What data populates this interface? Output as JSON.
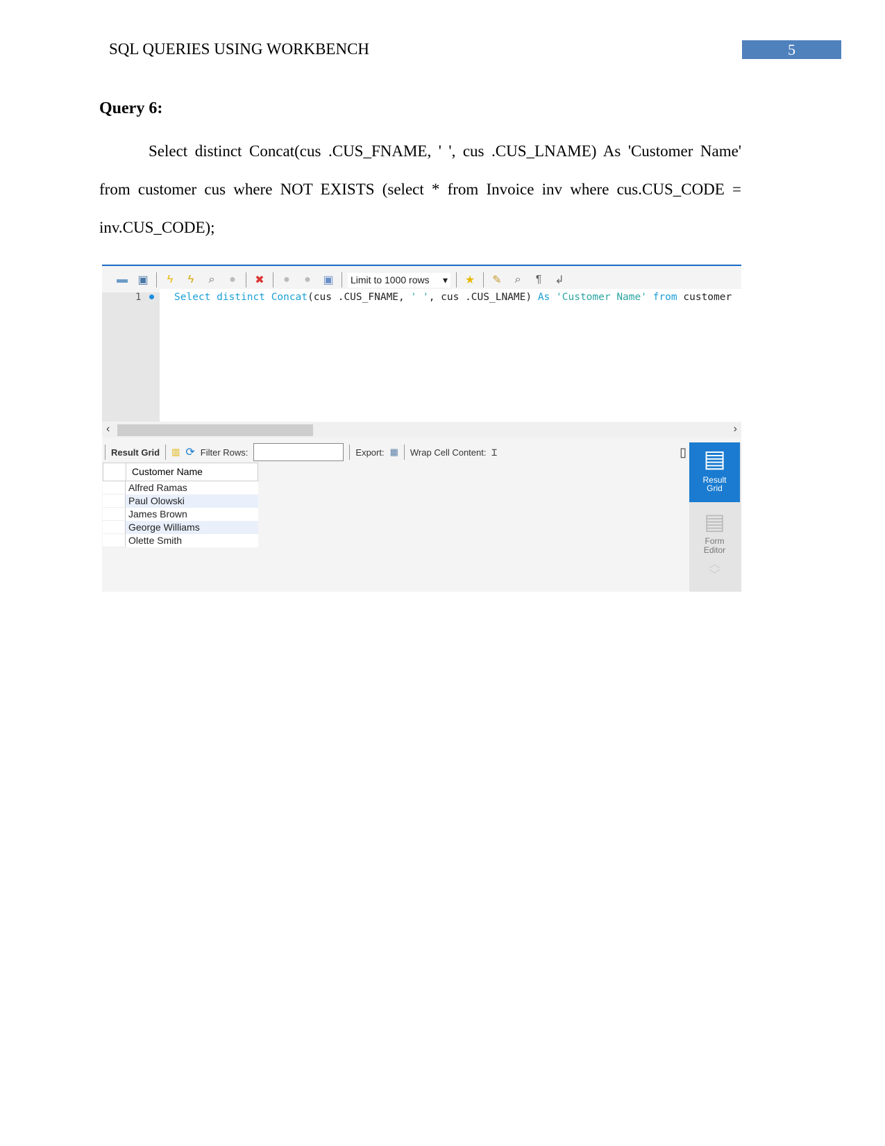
{
  "header": {
    "title": "SQL QUERIES USING WORKBENCH",
    "page_number": "5",
    "accent_color": "#4f81bd"
  },
  "query": {
    "heading": "Query 6:",
    "text": "Select distinct Concat(cus .CUS_FNAME, ' ', cus .CUS_LNAME) As 'Customer Name' from customer cus where NOT EXISTS (select * from Invoice inv where cus.CUS_CODE = inv.CUS_CODE);"
  },
  "workbench": {
    "limit_label": "Limit to 1000 rows",
    "line_number": "1",
    "code": {
      "t1": "Select distinct ",
      "t2": "Concat",
      "t3": "(cus .CUS_FNAME, ",
      "t4": "' '",
      "t5": ", cus .CUS_LNAME) ",
      "t6": "As ",
      "t7": "'Customer Name'",
      "t8": " from ",
      "t9": "customer"
    },
    "result_toolbar": {
      "result_grid": "Result Grid",
      "filter_rows": "Filter Rows:",
      "filter_value": "",
      "export": "Export:",
      "wrap": "Wrap Cell Content:"
    },
    "grid": {
      "column": "Customer Name",
      "rows": [
        "Alfred Ramas",
        "Paul Olowski",
        "James Brown",
        "George Williams",
        "Olette Smith"
      ]
    },
    "side": {
      "result_grid": "Result Grid",
      "form_editor": "Form Editor"
    }
  }
}
